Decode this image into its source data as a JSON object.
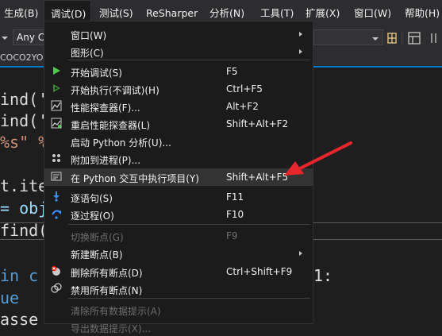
{
  "menubar": {
    "items": [
      "生成(B)",
      "调试(D)",
      "测试(S)",
      "ReSharper",
      "分析(N)",
      "工具(T)",
      "扩展(X)",
      "窗口(W)",
      "帮助(H)"
    ]
  },
  "toolbar": {
    "config_combo": "Any C"
  },
  "tab": {
    "title": "COCO2YO"
  },
  "code_lines": [
    "ind('",
    "ind('",
    "%s\" %",
    "t.ite",
    "= obj",
    "find(",
    "in c",
    "ue",
    "asse"
  ],
  "code_extra": {
    "right_colon": "1:"
  },
  "debug_menu": {
    "items": [
      {
        "label": "窗口(W)",
        "shortcut": "",
        "submenu": true,
        "icon": "",
        "disabled": false
      },
      {
        "label": "图形(C)",
        "shortcut": "",
        "submenu": true,
        "icon": "",
        "disabled": false
      },
      {
        "label": "开始调试(S)",
        "shortcut": "F5",
        "submenu": false,
        "icon": "play-green-icon",
        "disabled": false
      },
      {
        "label": "开始执行(不调试)(H)",
        "shortcut": "Ctrl+F5",
        "submenu": false,
        "icon": "play-outline-icon",
        "disabled": false
      },
      {
        "label": "性能探查器(F)...",
        "shortcut": "Alt+F2",
        "submenu": false,
        "icon": "performance-profiler-icon",
        "disabled": false
      },
      {
        "label": "重启性能探查器(L)",
        "shortcut": "Shift+Alt+F2",
        "submenu": false,
        "icon": "restart-profiler-icon",
        "disabled": false
      },
      {
        "label": "启动 Python 分析(U)...",
        "shortcut": "",
        "submenu": false,
        "icon": "",
        "disabled": false
      },
      {
        "label": "附加到进程(P)...",
        "shortcut": "",
        "submenu": false,
        "icon": "attach-process-icon",
        "disabled": false
      },
      {
        "label": "在 Python 交互中执行项目(Y)",
        "shortcut": "Shift+Alt+F5",
        "submenu": false,
        "icon": "python-interactive-icon",
        "disabled": false
      },
      {
        "label": "逐语句(S)",
        "shortcut": "F11",
        "submenu": false,
        "icon": "step-into-icon",
        "disabled": false
      },
      {
        "label": "逐过程(O)",
        "shortcut": "F10",
        "submenu": false,
        "icon": "step-over-icon",
        "disabled": false
      },
      {
        "label": "切换断点(G)",
        "shortcut": "F9",
        "submenu": false,
        "icon": "",
        "disabled": true
      },
      {
        "label": "新建断点(B)",
        "shortcut": "",
        "submenu": true,
        "icon": "",
        "disabled": false
      },
      {
        "label": "删除所有断点(D)",
        "shortcut": "Ctrl+Shift+F9",
        "submenu": false,
        "icon": "delete-breakpoints-icon",
        "disabled": false
      },
      {
        "label": "禁用所有断点(N)",
        "shortcut": "",
        "submenu": false,
        "icon": "disable-breakpoints-icon",
        "disabled": false
      },
      {
        "label": "清除所有数据提示(A)",
        "shortcut": "",
        "submenu": false,
        "icon": "",
        "disabled": true
      },
      {
        "label": "导出数据提示(X)...",
        "shortcut": "",
        "submenu": false,
        "icon": "",
        "disabled": true
      }
    ]
  },
  "colors": {
    "accent": "#007acc",
    "annotation_arrow": "#e8262b",
    "menu_bg": "#1b1b1c",
    "code_blue": "#569cd6",
    "code_string": "#ce9178",
    "code_text": "#9cdcfe"
  }
}
